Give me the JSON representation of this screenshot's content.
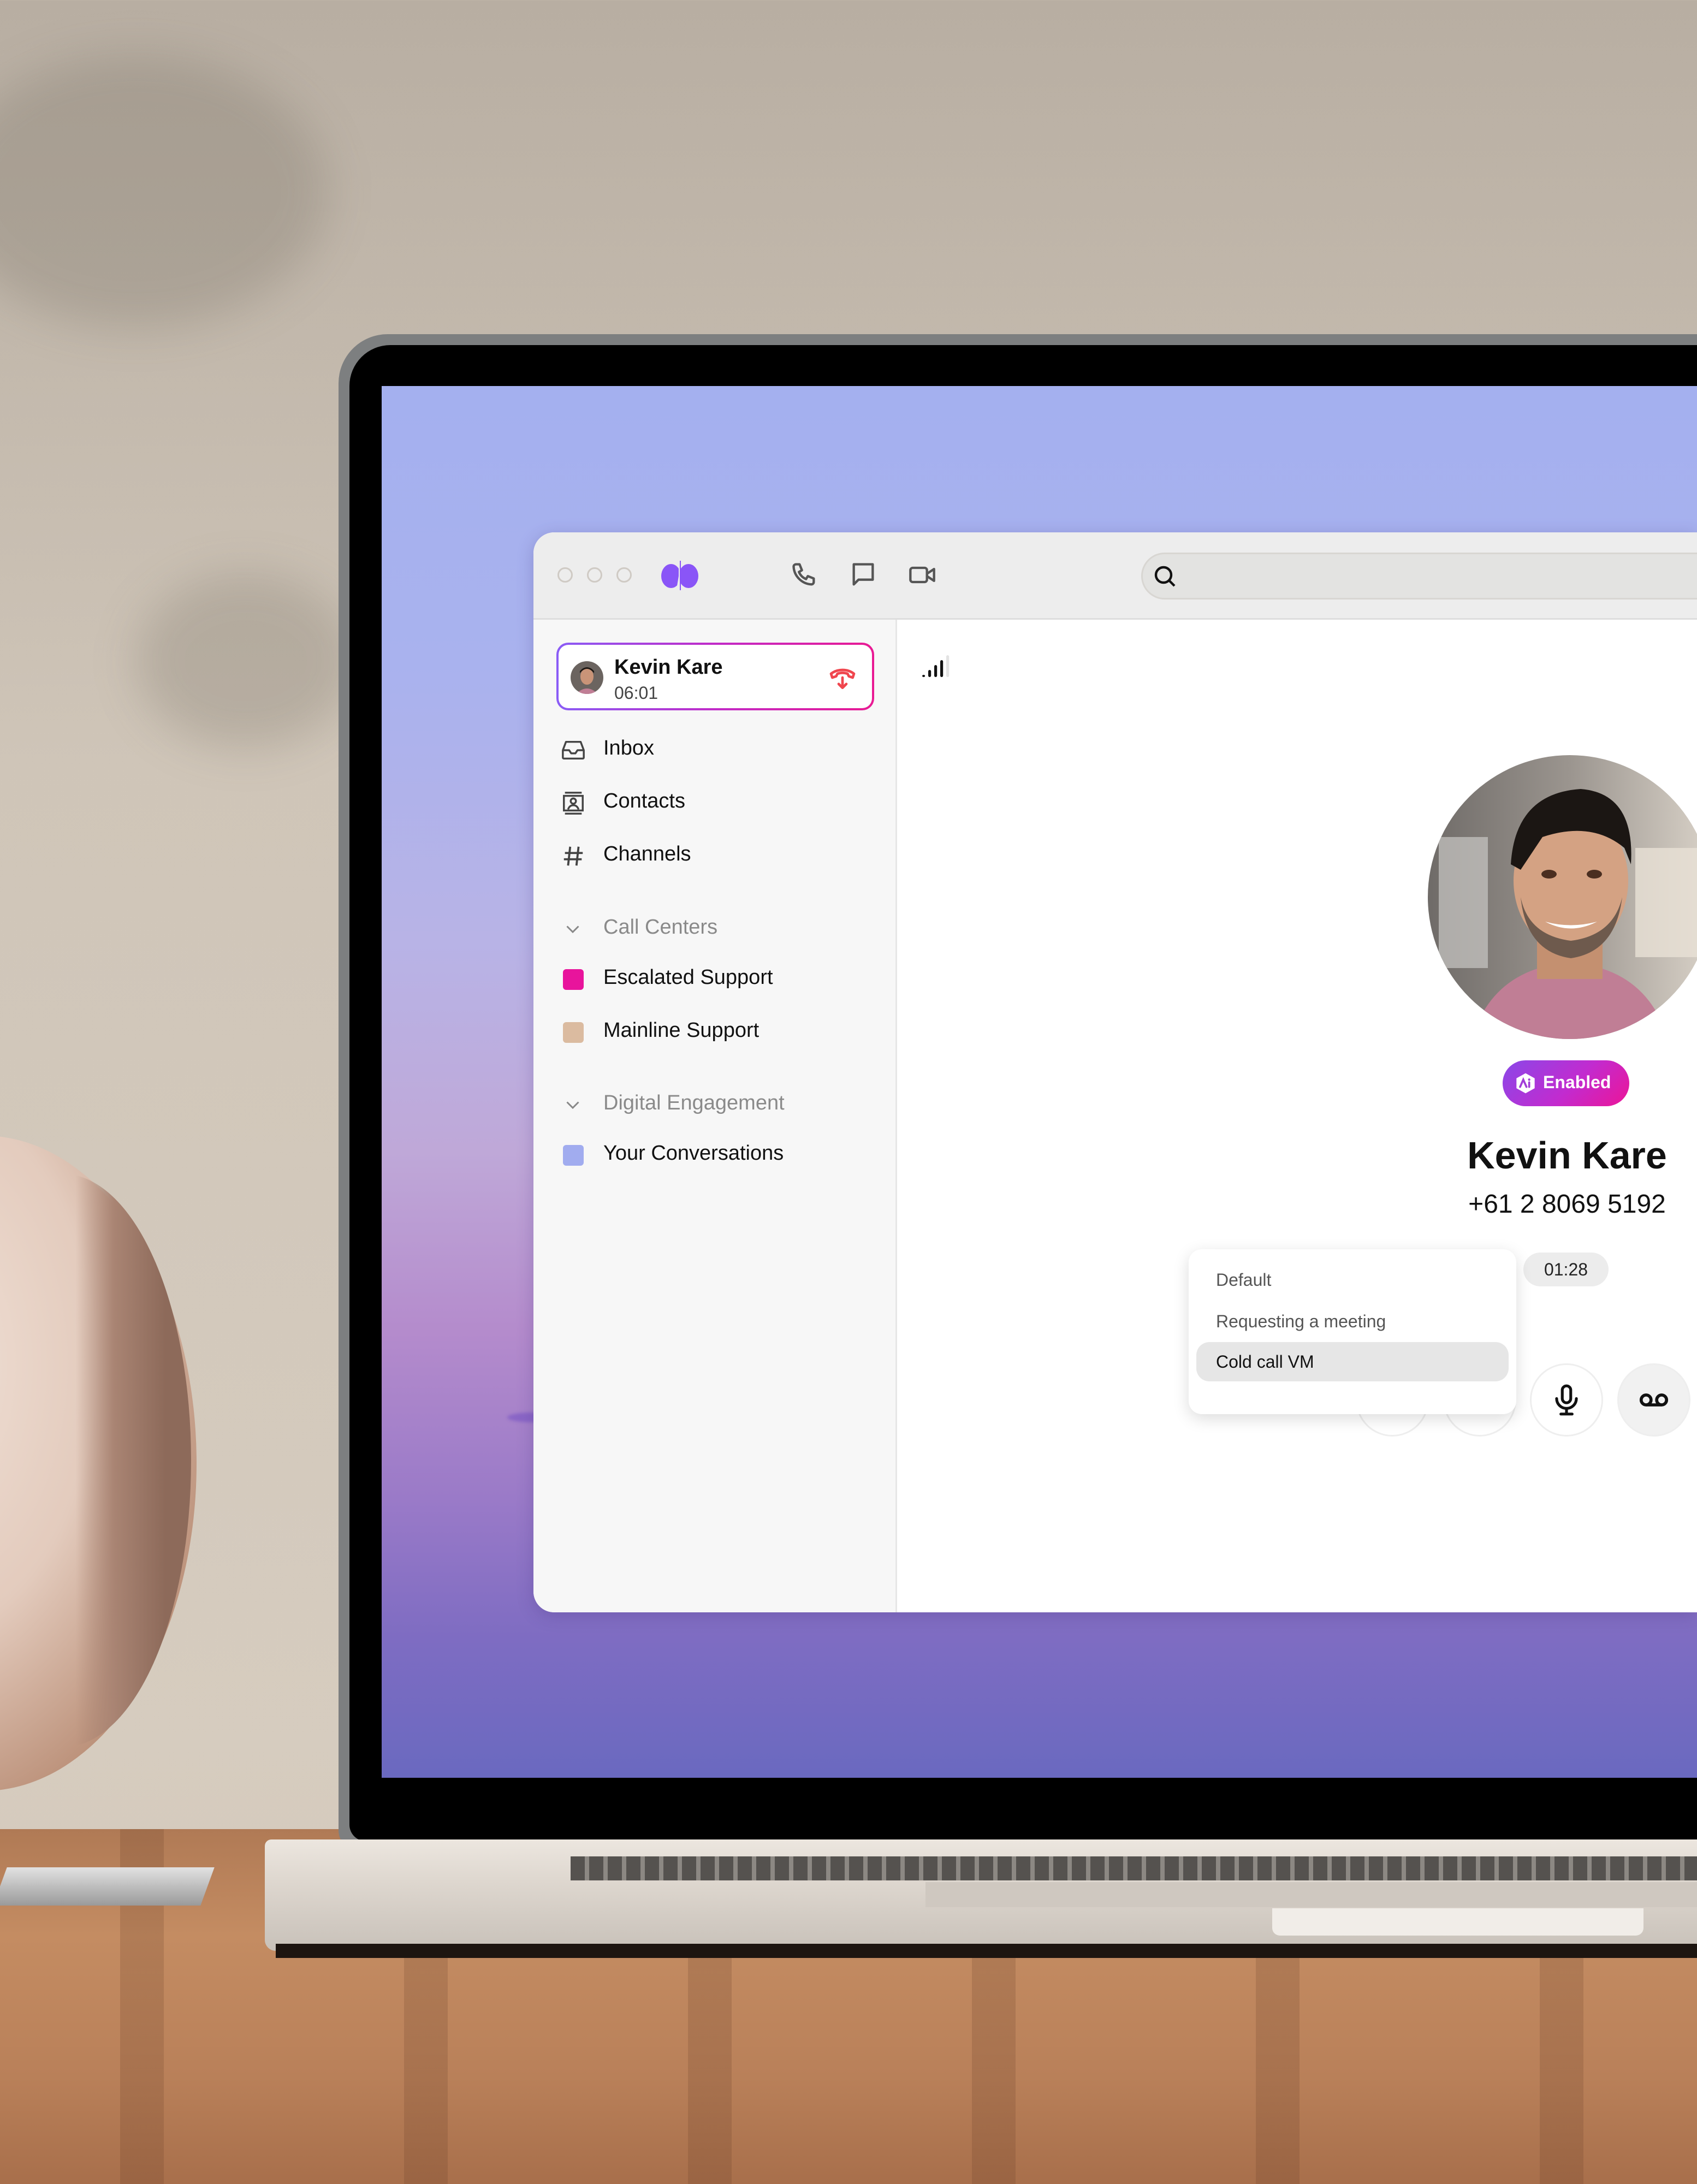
{
  "titlebar": {
    "window_controls": [
      "close",
      "minimize",
      "maximize"
    ],
    "logo": "dialpad-logo",
    "nav_icons": [
      "phone-icon",
      "message-icon",
      "video-icon"
    ],
    "search": {
      "placeholder": "",
      "value": "",
      "icon": "search-icon"
    },
    "brand_color": "#8a55f7"
  },
  "active_call": {
    "name": "Kevin Kare",
    "duration": "06:01",
    "hangup_icon": "hangup-icon",
    "border_gradient": [
      "#8a5cf6",
      "#e91a93"
    ]
  },
  "sidebar": {
    "nav": [
      {
        "label": "Inbox",
        "icon": "inbox-icon"
      },
      {
        "label": "Contacts",
        "icon": "contacts-icon"
      },
      {
        "label": "Channels",
        "icon": "hash-icon"
      }
    ],
    "sections": [
      {
        "title": "Call Centers",
        "expanded": true,
        "items": [
          {
            "label": "Escalated Support",
            "color": "#e8149c"
          },
          {
            "label": "Mainline Support",
            "color": "#dbbba0"
          }
        ]
      },
      {
        "title": "Digital Engagement",
        "expanded": true,
        "items": [
          {
            "label": "Your Conversations",
            "color": "#a1acef"
          }
        ]
      }
    ]
  },
  "call": {
    "signal_strength": {
      "active_bars": 4,
      "total_bars": 5
    },
    "ai_badge": "Enabled",
    "contact_name": "Kevin Kare",
    "contact_phone": "+61 2 8069 5192",
    "voicemail_timer": "01:28",
    "voicemail_menu": {
      "options": [
        "Default",
        "Requesting a meeting",
        "Cold call VM"
      ],
      "selected": "Cold call VM"
    },
    "controls": [
      "keypad-button",
      "transfer-button",
      "mute-button",
      "voicemail-drop-button"
    ]
  }
}
